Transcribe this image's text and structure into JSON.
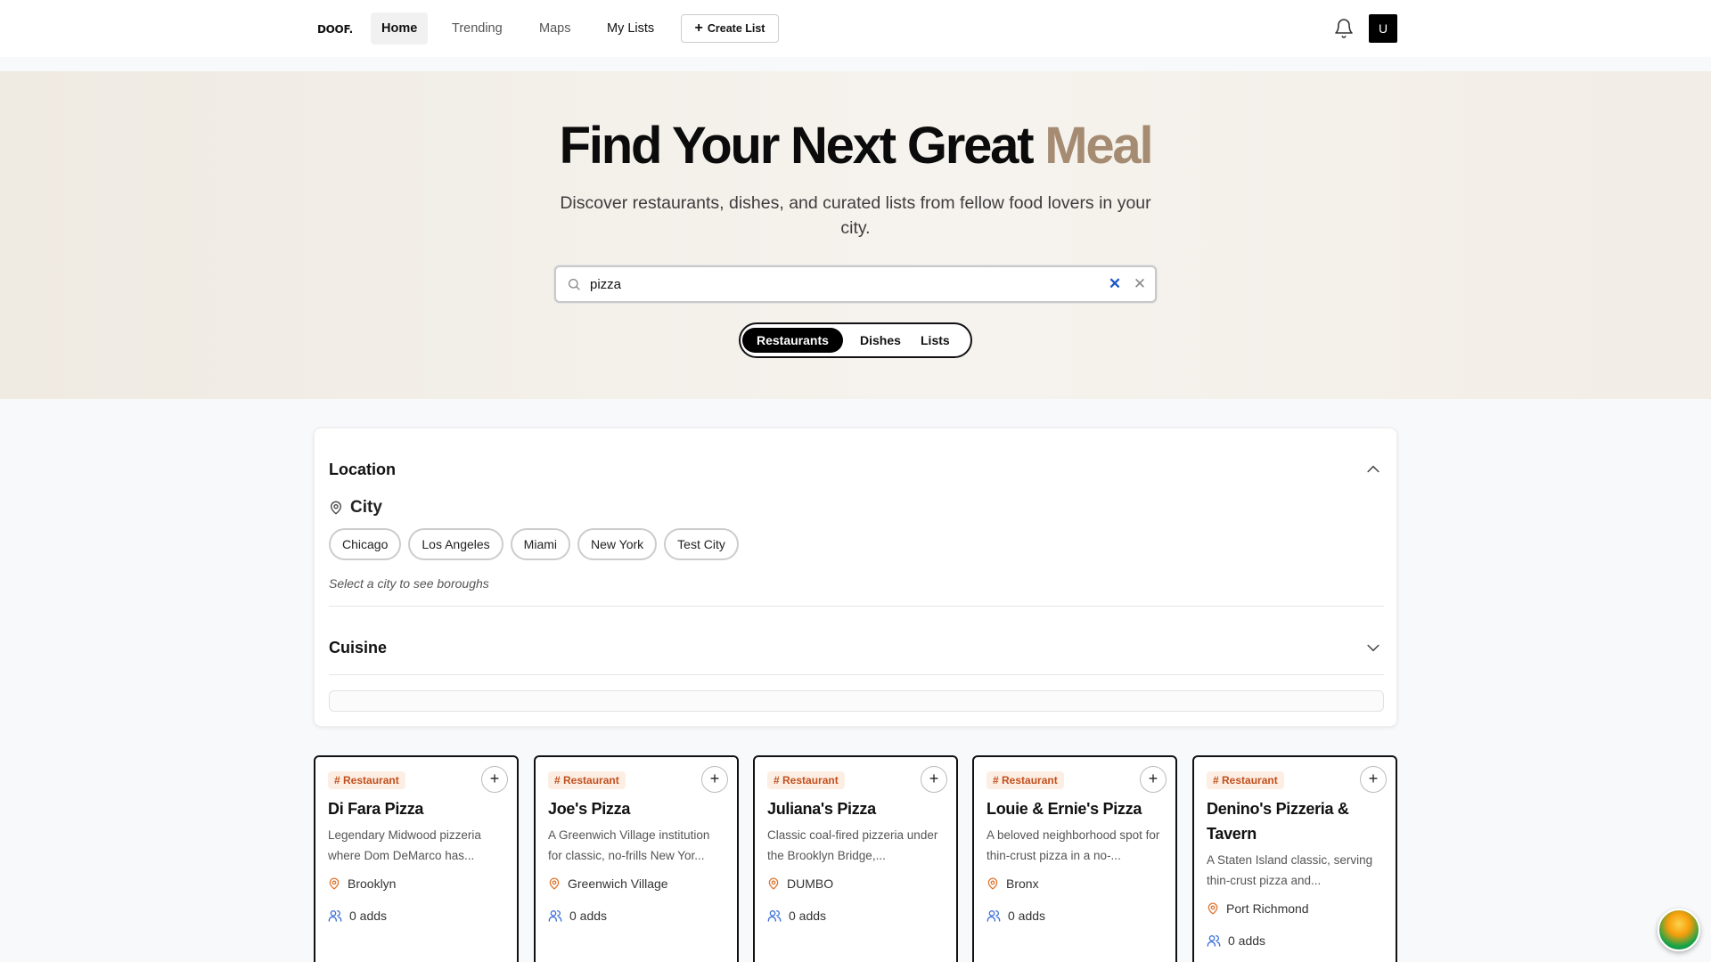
{
  "nav": {
    "logo": "DOOF.",
    "items": [
      {
        "label": "Home"
      },
      {
        "label": "Trending"
      },
      {
        "label": "Maps"
      },
      {
        "label": "My Lists"
      }
    ],
    "create_label": "Create List",
    "avatar_letter": "U"
  },
  "hero": {
    "title_main": "Find Your Next Great ",
    "title_accent": "Meal",
    "subtitle": "Discover restaurants, dishes, and curated lists from fellow food lovers in your city.",
    "search_value": "pizza",
    "tabs": [
      {
        "label": "Restaurants"
      },
      {
        "label": "Dishes"
      },
      {
        "label": "Lists"
      }
    ]
  },
  "filters": {
    "location_title": "Location",
    "city_label": "City",
    "cities": [
      "Chicago",
      "Los Angeles",
      "Miami",
      "New York",
      "Test City"
    ],
    "hint": "Select a city to see boroughs",
    "cuisine_title": "Cuisine"
  },
  "cards": [
    {
      "tag": "Restaurant",
      "name": "Di Fara Pizza",
      "desc": "Legendary Midwood pizzeria where Dom DeMarco has...",
      "location": "Brooklyn",
      "adds": "0 adds"
    },
    {
      "tag": "Restaurant",
      "name": "Joe's Pizza",
      "desc": "A Greenwich Village institution for classic, no-frills New Yor...",
      "location": "Greenwich Village",
      "adds": "0 adds"
    },
    {
      "tag": "Restaurant",
      "name": "Juliana's Pizza",
      "desc": "Classic coal-fired pizzeria under the Brooklyn Bridge,...",
      "location": "DUMBO",
      "adds": "0 adds"
    },
    {
      "tag": "Restaurant",
      "name": "Louie & Ernie's Pizza",
      "desc": "A beloved neighborhood spot for thin-crust pizza in a no-...",
      "location": "Bronx",
      "adds": "0 adds"
    },
    {
      "tag": "Restaurant",
      "name": "Denino's Pizzeria & Tavern",
      "desc": "A Staten Island classic, serving thin-crust pizza and...",
      "location": "Port Richmond",
      "adds": "0 adds"
    }
  ],
  "colors": {
    "accent": "#a58b72",
    "tag_text": "#c1501d",
    "tag_bg": "#fdeee4",
    "clear_blue": "#1c58c9"
  }
}
